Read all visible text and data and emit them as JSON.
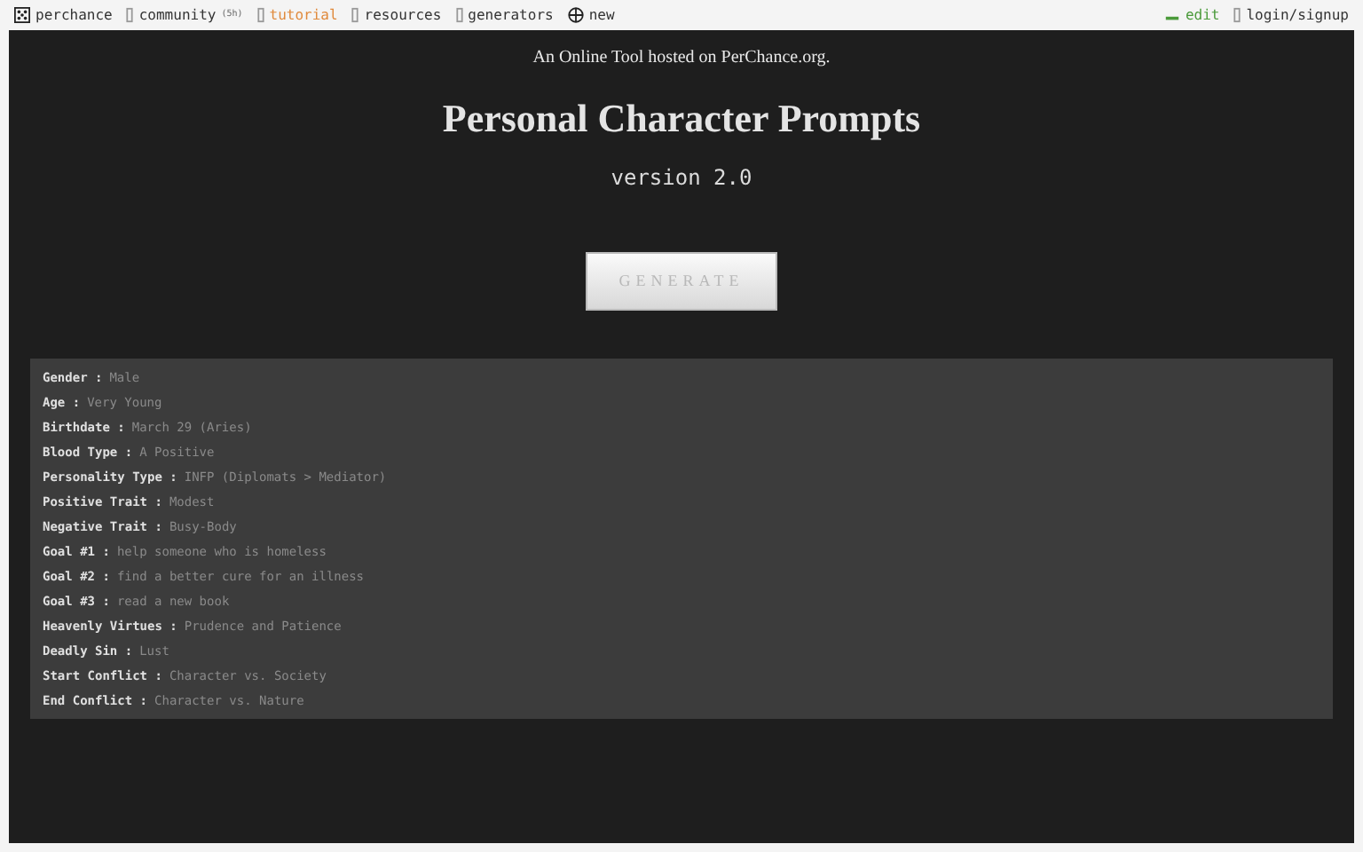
{
  "nav": {
    "left": [
      {
        "label": "perchance",
        "kind": "dice"
      },
      {
        "label": "community",
        "badge": "(5h)",
        "kind": "box"
      },
      {
        "label": "tutorial",
        "kind": "box",
        "color": "#e08a3c"
      },
      {
        "label": "resources",
        "kind": "box"
      },
      {
        "label": "generators",
        "kind": "box"
      },
      {
        "label": "new",
        "kind": "plus"
      }
    ],
    "right": [
      {
        "label": "edit",
        "kind": "pencil",
        "color": "#4a9a3a"
      },
      {
        "label": "login/signup",
        "kind": "box"
      }
    ]
  },
  "hosted_note": "An Online Tool hosted on PerChance.org.",
  "title": "Personal Character Prompts",
  "version": "version 2.0",
  "generate_button": "GENERATE",
  "results": [
    {
      "label": "Gender :",
      "value": "Male"
    },
    {
      "label": "Age :",
      "value": "Very Young"
    },
    {
      "label": "Birthdate :",
      "value": "March 29 (Aries)"
    },
    {
      "label": "Blood Type :",
      "value": "A Positive"
    },
    {
      "label": "Personality Type :",
      "value": "INFP (Diplomats > Mediator)"
    },
    {
      "label": "Positive Trait :",
      "value": "Modest"
    },
    {
      "label": "Negative Trait :",
      "value": "Busy-Body"
    },
    {
      "label": "Goal #1 :",
      "value": "help someone who is homeless"
    },
    {
      "label": "Goal #2 :",
      "value": "find a better cure for an illness"
    },
    {
      "label": "Goal #3 :",
      "value": "read a new book"
    },
    {
      "label": "Heavenly Virtues :",
      "value": "Prudence and Patience"
    },
    {
      "label": "Deadly Sin :",
      "value": "Lust"
    },
    {
      "label": "Start Conflict :",
      "value": "Character vs. Society"
    },
    {
      "label": "End Conflict :",
      "value": "Character vs. Nature"
    }
  ]
}
